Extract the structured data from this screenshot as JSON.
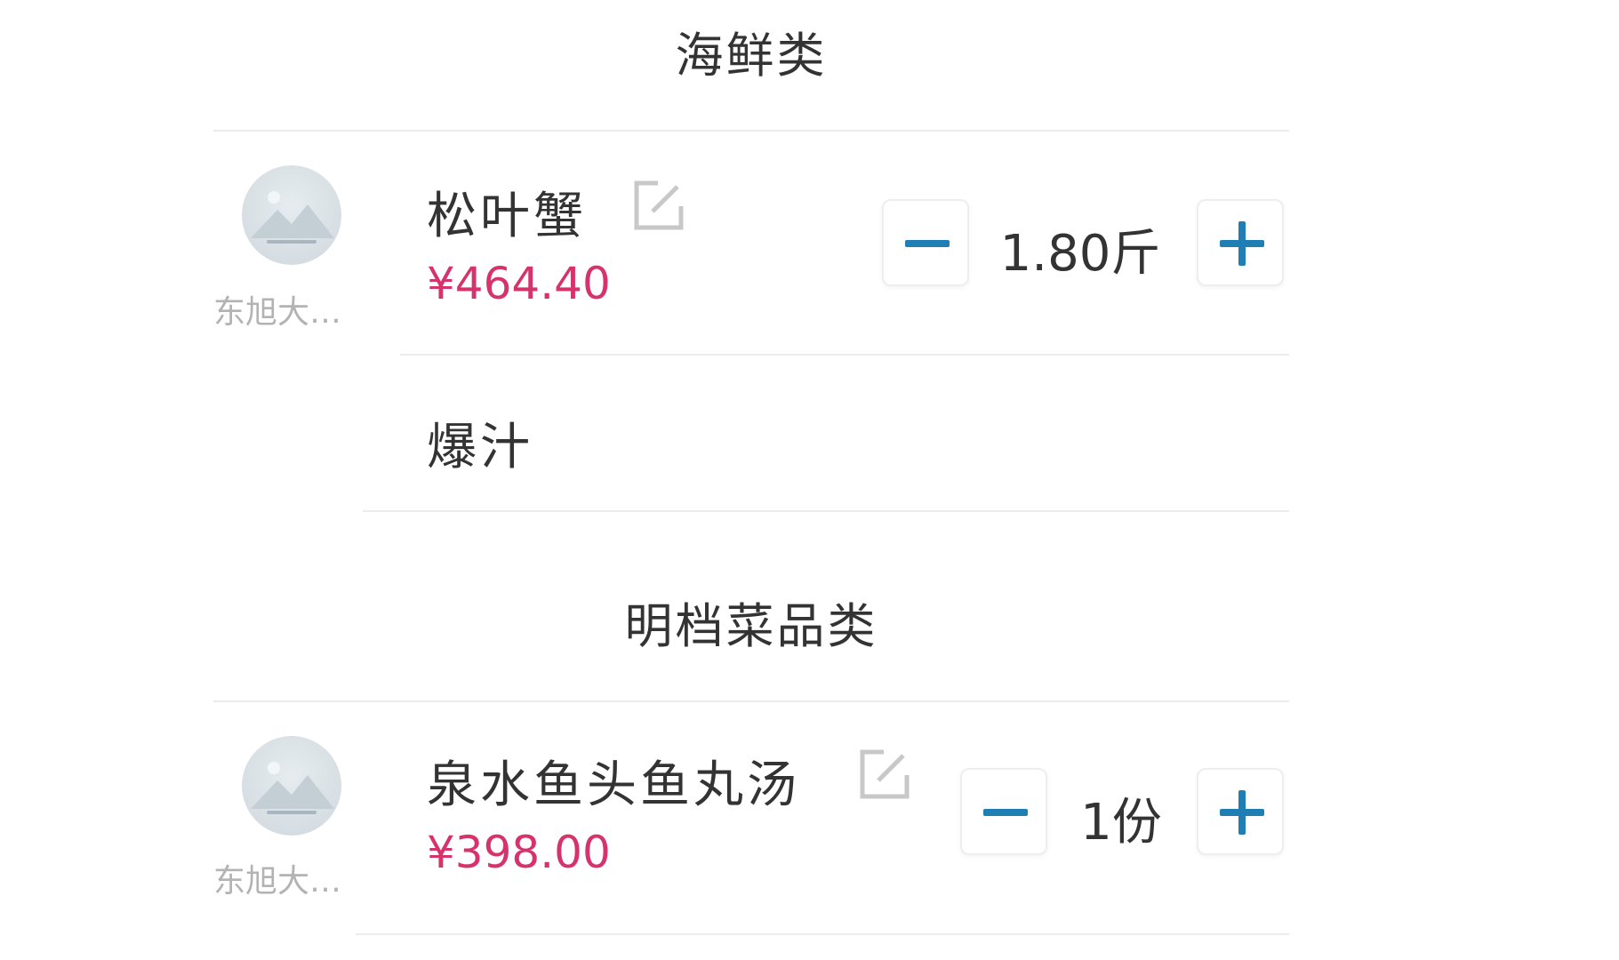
{
  "categories": [
    {
      "title": "海鲜类",
      "item": {
        "shop_name": "东旭大…",
        "name": "松叶蟹",
        "price": "¥464.40",
        "quantity": "1.80斤",
        "note": "爆汁"
      }
    },
    {
      "title": "明档菜品类",
      "item": {
        "shop_name": "东旭大…",
        "name": "泉水鱼头鱼丸汤",
        "price": "¥398.00",
        "quantity": "1份"
      }
    }
  ],
  "icons": {
    "edit": "edit-icon",
    "minus": "minus-icon",
    "plus": "plus-icon",
    "avatar": "shop-logo-placeholder"
  },
  "colors": {
    "price": "#d6336c",
    "stepper_icon": "#1f7fb5",
    "edit_icon": "#c8c8c8",
    "divider": "#ececec"
  }
}
